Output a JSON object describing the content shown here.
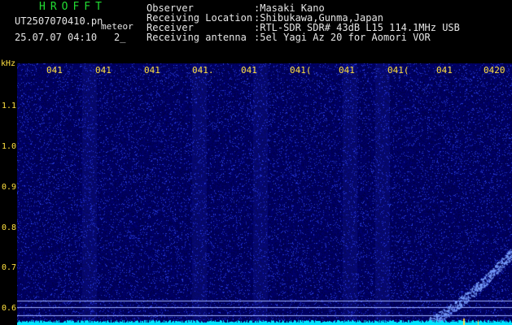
{
  "header": {
    "program": "HROFFT",
    "file_name": "UT2507070410.pn",
    "tag": "meteor",
    "datetime": "25.07.07 04:10",
    "count": "2_",
    "info_rows": [
      {
        "key": "Observer",
        "value": ":Masaki Kano"
      },
      {
        "key": "Receiving Location",
        "value": ":Shibukawa,Gunma,Japan"
      },
      {
        "key": "Receiver",
        "value": ":RTL-SDR SDR# 43dB L15 114.1MHz USB"
      },
      {
        "key": "Receiving antenna",
        "value": ":5el Yagi Az 20 for Aomori VOR"
      }
    ]
  },
  "spectrogram": {
    "y_unit": "kHz",
    "y_ticks": [
      "1.1",
      "1.0",
      "0.9",
      "0.8",
      "0.7",
      "0.6"
    ],
    "x_ticks": [
      "041",
      "041",
      "041",
      "041.",
      "041",
      "041(",
      "041",
      "041(",
      "041",
      "0420"
    ],
    "colors": {
      "background": "#000060",
      "noise": "#3344ff",
      "signal": "#00e5ff",
      "axis_text": "#ffe040",
      "title": "#22dd33"
    }
  }
}
